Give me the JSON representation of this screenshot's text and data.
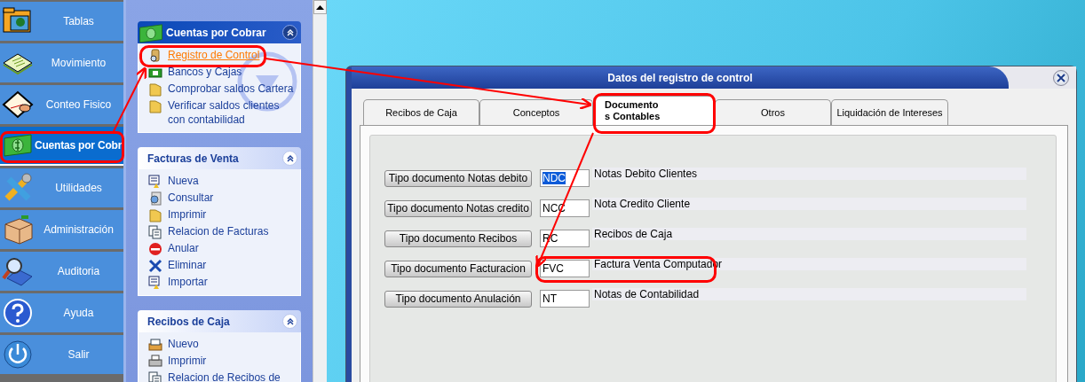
{
  "sidebar": {
    "items": [
      {
        "label": "Tablas",
        "selected": false
      },
      {
        "label": "Movimiento",
        "selected": false
      },
      {
        "label": "Conteo Fisico",
        "selected": false
      },
      {
        "label": "Cuentas por Cobr",
        "selected": true
      },
      {
        "label": "Utilidades",
        "selected": false
      },
      {
        "label": "Administración",
        "selected": false
      },
      {
        "label": "Auditoria",
        "selected": false
      },
      {
        "label": "Ayuda",
        "selected": false
      },
      {
        "label": "Salir",
        "selected": false
      }
    ]
  },
  "task_pane": {
    "groups": [
      {
        "title": "Cuentas por Cobrar",
        "kind": "primary",
        "expanded": true,
        "items": [
          {
            "label": "Registro de Control",
            "hovered": true
          },
          {
            "label": "Bancos y Cajas",
            "hovered": false
          },
          {
            "label": "Comprobar saldos Cartera",
            "hovered": false
          },
          {
            "label": "Verificar saldos clientes con contabilidad",
            "hovered": false
          }
        ]
      },
      {
        "title": "Facturas de Venta",
        "kind": "normal",
        "expanded": true,
        "items": [
          {
            "label": "Nueva",
            "hovered": false
          },
          {
            "label": "Consultar",
            "hovered": false
          },
          {
            "label": "Imprimir",
            "hovered": false
          },
          {
            "label": "Relacion de Facturas",
            "hovered": false
          },
          {
            "label": "Anular",
            "hovered": false
          },
          {
            "label": "Eliminar",
            "hovered": false
          },
          {
            "label": "Importar",
            "hovered": false
          }
        ]
      },
      {
        "title": "Recibos de Caja",
        "kind": "normal",
        "expanded": true,
        "items": [
          {
            "label": "Nuevo",
            "hovered": false
          },
          {
            "label": "Imprimir",
            "hovered": false
          },
          {
            "label": "Relacion de Recibos de",
            "hovered": false
          }
        ]
      }
    ]
  },
  "dialog": {
    "title": "Datos del registro de control",
    "tabs": [
      {
        "label": "Recibos de Caja",
        "selected": false
      },
      {
        "label": "Conceptos",
        "selected": false
      },
      {
        "label": "Documento\ns Contables",
        "selected": true
      },
      {
        "label": "Otros",
        "selected": false
      },
      {
        "label": "Liquidación de Intereses",
        "selected": false
      }
    ],
    "rows": [
      {
        "button": "Tipo documento Notas debito",
        "code": "NDC",
        "code_selected": true,
        "description": "Notas Debito Clientes"
      },
      {
        "button": "Tipo documento Notas credito",
        "code": "NCC",
        "code_selected": false,
        "description": "Nota Credito Cliente"
      },
      {
        "button": "Tipo documento Recibos",
        "code": "RC",
        "code_selected": false,
        "description": "Recibos de Caja"
      },
      {
        "button": "Tipo documento Facturacion",
        "code": "FVC",
        "code_selected": false,
        "description": "Factura Venta Computador"
      },
      {
        "button": "Tipo documento Anulación",
        "code": "NT",
        "code_selected": false,
        "description": "Notas de Contabilidad"
      }
    ]
  }
}
